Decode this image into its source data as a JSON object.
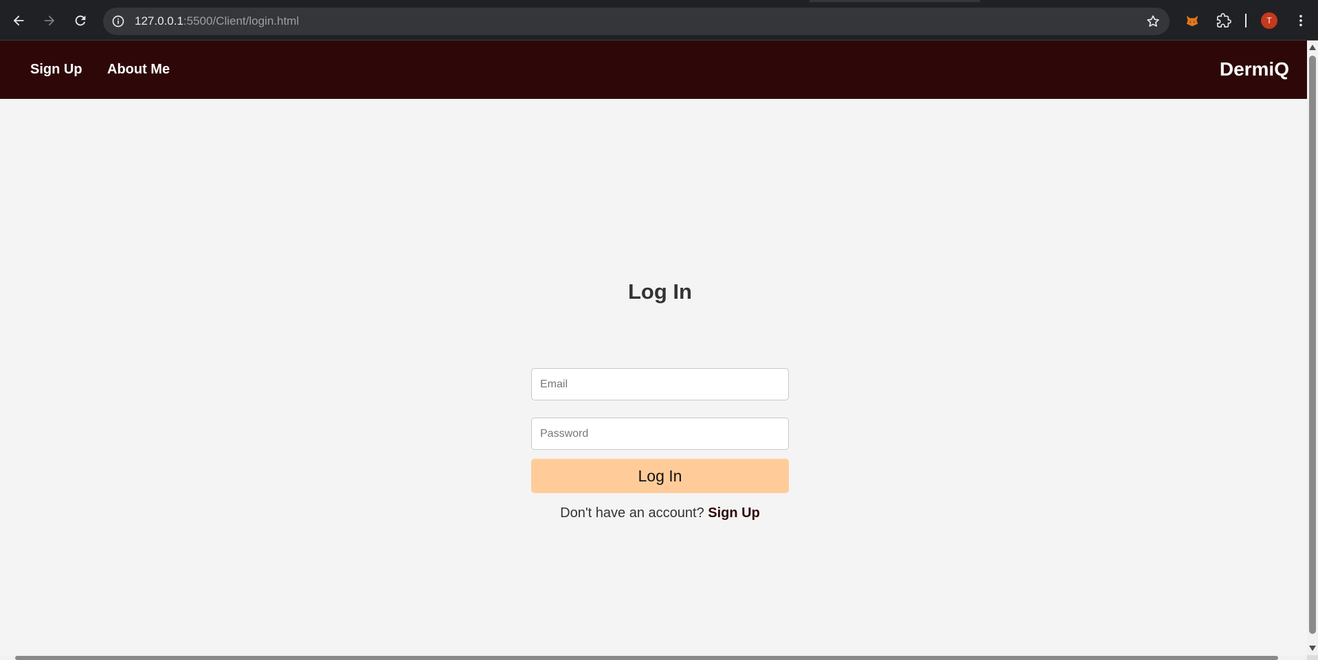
{
  "browser": {
    "url_host": "127.0.0.1",
    "url_rest": ":5500/Client/login.html",
    "profile_initial": "T",
    "icons": {
      "back": "back-arrow-icon",
      "forward": "forward-arrow-icon",
      "reload": "reload-icon",
      "site_info": "info-icon",
      "bookmark": "star-icon",
      "extension_fox": "fox-extension-icon",
      "extensions": "puzzle-icon",
      "menu": "kebab-menu-icon"
    }
  },
  "site_nav": {
    "links": [
      {
        "label": "Sign Up"
      },
      {
        "label": "About Me"
      }
    ],
    "brand": "DermiQ",
    "background_color": "#2e0808"
  },
  "login": {
    "title": "Log In",
    "email_placeholder": "Email",
    "email_value": "",
    "password_placeholder": "Password",
    "password_value": "",
    "submit_label": "Log In",
    "submit_color": "#ffcc99",
    "prompt_text": "Don't have an account?",
    "signup_link_label": "Sign Up"
  }
}
